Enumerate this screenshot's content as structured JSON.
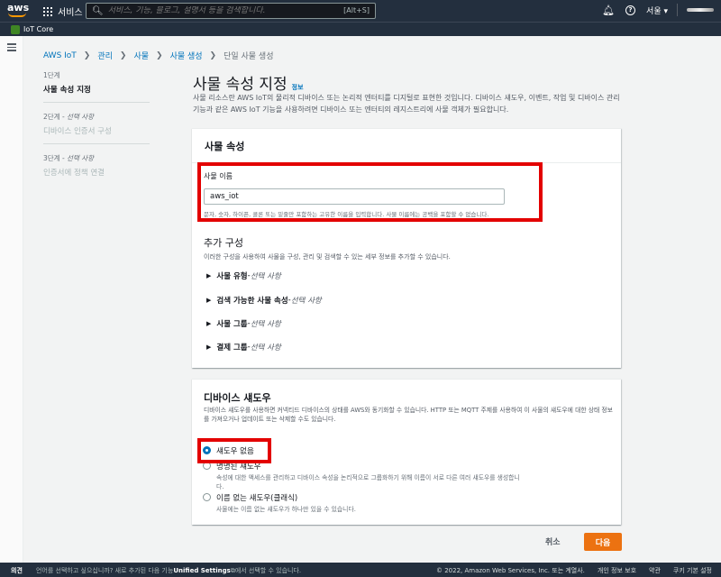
{
  "nav": {
    "logo": "aws",
    "services": "서비스",
    "search_placeholder": "서비스, 기능, 블로그, 설명서 등을 검색합니다.",
    "search_shortcut": "[Alt+S]",
    "region": "서울 ▾"
  },
  "service": {
    "name": "IoT Core"
  },
  "breadcrumb": [
    "AWS IoT",
    "관리",
    "사물",
    "사물 생성",
    "단일 사물 생성"
  ],
  "steps": [
    {
      "num": "1단계",
      "optional": "",
      "name": "사물 속성 지정"
    },
    {
      "num": "2단계 - ",
      "optional": "선택 사항",
      "name": "디바이스 인증서 구성"
    },
    {
      "num": "3단계 - ",
      "optional": "선택 사항",
      "name": "인증서에 정책 연결"
    }
  ],
  "page": {
    "title": "사물 속성 지정",
    "info": "정보",
    "description": "사물 리소스란 AWS IoT의 물리적 디바이스 또는 논리적 엔터티를 디지털로 표현한 것입니다. 디바이스 섀도우, 이벤트, 작업 및 디바이스 관리 기능과 같은 AWS IoT 기능을 사용하려면 디바이스 또는 엔터티의 레지스트리에 사물 객체가 필요합니다."
  },
  "props": {
    "header": "사물 속성",
    "name_label": "사물 이름",
    "name_value": "aws_iot",
    "name_hint": "문자, 숫자, 하이픈, 콜론 또는 밑줄만 포함하는 고유한 이름을 입력합니다. 사물 이름에는 공백을 포함할 수 없습니다."
  },
  "additional": {
    "title": "추가 구성",
    "subtitle": "이러한 구성을 사용하여 사물을 구성, 관리 및 검색할 수 있는 세부 정보를 추가할 수 있습니다.",
    "items": [
      {
        "label": "사물 유형",
        "sep": " - ",
        "opt": "선택 사항"
      },
      {
        "label": "검색 가능한 사물 속성",
        "sep": " - ",
        "opt": "선택 사항"
      },
      {
        "label": "사물 그룹",
        "sep": " - ",
        "opt": "선택 사항"
      },
      {
        "label": "결제 그룹",
        "sep": " - ",
        "opt": "선택 사항"
      }
    ]
  },
  "shadow": {
    "title": "디바이스 섀도우",
    "description": "디바이스 섀도우를 사용하면 커넥티드 디바이스의 상태를 AWS와 동기화할 수 있습니다. HTTP 또는 MQTT 주제를 사용하여 이 사물의 섀도우에 대한 상태 정보를 가져오거나 업데이트 또는 삭제할 수도 있습니다.",
    "options": [
      {
        "label": "섀도우 없음",
        "desc": "",
        "selected": true
      },
      {
        "label": "명명된 섀도우",
        "desc": "속성에 대한 액세스를 관리하고 디바이스 속성을 논리적으로 그룹화하기 위해 이름이 서로 다른 여러 섀도우를 생성합니다.",
        "selected": false
      },
      {
        "label": "이름 없는 섀도우(클래식)",
        "desc": "사물에는 이름 없는 섀도우가 하나만 있을 수 있습니다.",
        "selected": false
      }
    ]
  },
  "actions": {
    "cancel": "취소",
    "next": "다음"
  },
  "footer": {
    "feedback": "의견",
    "message_pre": "언어를 선택하고 싶으십니까? 새로 추가된 다음 기능",
    "message_bold": "Unified Settings",
    "message_post": "에서 선택할 수 있습니다.",
    "copyright": "© 2022, Amazon Web Services, Inc. 또는 계열사.",
    "privacy": "개인 정보 보호",
    "terms": "약관",
    "cookies": "쿠키 기본 설정"
  },
  "colors": {
    "accent": "#ec7211",
    "link": "#0073bb",
    "highlight": "#e30000",
    "nav_bg": "#232f3e"
  }
}
